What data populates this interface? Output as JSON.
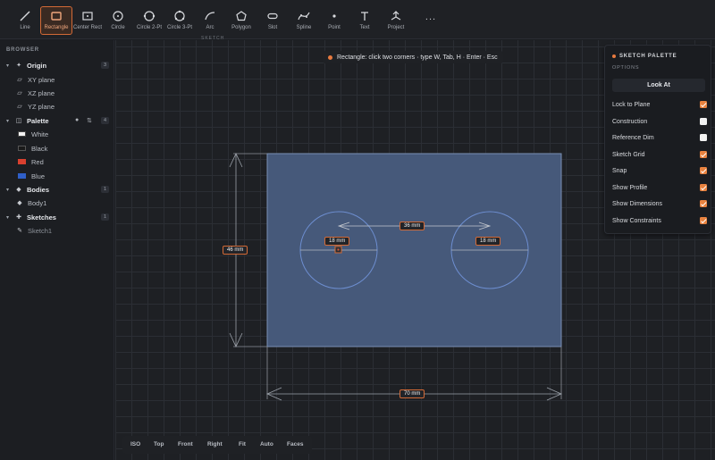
{
  "toolbar": {
    "tools": [
      {
        "label": "Line",
        "icon": "line-icon"
      },
      {
        "label": "Rectangle",
        "icon": "rectangle-icon",
        "active": true
      },
      {
        "label": "Center Rect",
        "icon": "center-rect-icon"
      },
      {
        "label": "Circle",
        "icon": "circle-icon"
      },
      {
        "label": "Circle 2-Pt",
        "icon": "circle-2pt-icon"
      },
      {
        "label": "Circle 3-Pt",
        "icon": "circle-3pt-icon"
      },
      {
        "label": "Arc",
        "icon": "arc-icon"
      },
      {
        "label": "Polygon",
        "icon": "polygon-icon"
      },
      {
        "label": "Slot",
        "icon": "slot-icon"
      },
      {
        "label": "Spline",
        "icon": "spline-icon"
      },
      {
        "label": "Point",
        "icon": "point-icon"
      },
      {
        "label": "Text",
        "icon": "text-icon"
      },
      {
        "label": "Project",
        "icon": "project-icon"
      }
    ],
    "more_label": "...",
    "section_tag": "SKETCH"
  },
  "sidebar": {
    "header": "BROWSER",
    "origin": {
      "label": "Origin",
      "count": "3",
      "items": [
        "XY plane",
        "XZ plane",
        "YZ plane"
      ]
    },
    "palette": {
      "label": "Palette",
      "count": "4",
      "items": [
        {
          "label": "White",
          "color": "#f2f2f2"
        },
        {
          "label": "Black",
          "color": "#1a1a1a"
        },
        {
          "label": "Red",
          "color": "#d9402f"
        },
        {
          "label": "Blue",
          "color": "#2f5fc8"
        }
      ]
    },
    "bodies": {
      "label": "Bodies",
      "count": "1",
      "items": [
        "Body1"
      ]
    },
    "sketches": {
      "label": "Sketches",
      "count": "1",
      "items": [
        "Sketch1"
      ]
    }
  },
  "canvas": {
    "hint": "Rectangle: click two corners · type W, Tab, H · Enter · Esc",
    "dims": {
      "width": "70 mm",
      "height": "46 mm",
      "hole_spacing": "36 mm",
      "hole_left_dia": "18 mm",
      "hole_right_dia": "18 mm"
    },
    "rect_fill": "#46597a",
    "accent": "#d36a36"
  },
  "sketch_palette": {
    "title": "SKETCH PALETTE",
    "subtitle": "OPTIONS",
    "look_at": "Look At",
    "options": [
      {
        "label": "Lock to Plane",
        "checked": true
      },
      {
        "label": "Construction",
        "checked": false
      },
      {
        "label": "Reference Dim",
        "checked": false
      },
      {
        "label": "Sketch Grid",
        "checked": true
      },
      {
        "label": "Snap",
        "checked": true
      },
      {
        "label": "Show Profile",
        "checked": true
      },
      {
        "label": "Show Dimensions",
        "checked": true
      },
      {
        "label": "Show Constraints",
        "checked": true
      }
    ]
  },
  "viewbar": {
    "items": [
      "ISO",
      "Top",
      "Front",
      "Right",
      "Fit",
      "Auto",
      "Faces"
    ]
  }
}
